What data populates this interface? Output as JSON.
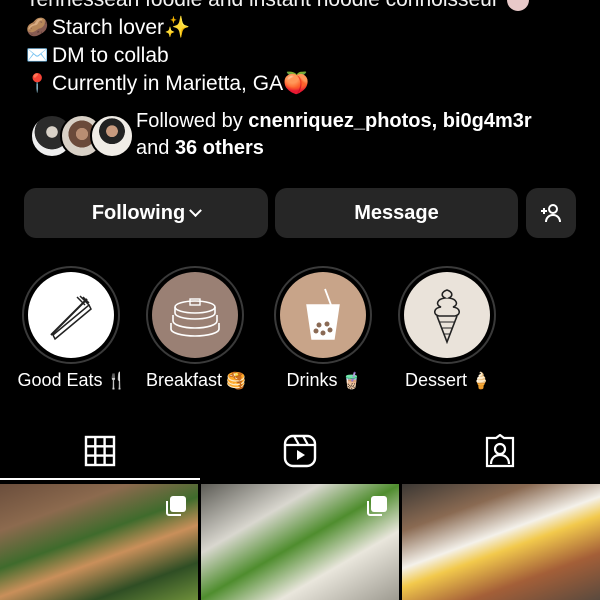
{
  "bio": {
    "cut_line": "Tennessean foodie and instant noodle connoisseur",
    "lines": [
      {
        "icon": "potato-emoji",
        "glyph": "🥔",
        "text": "Starch lover✨"
      },
      {
        "icon": "envelope-emoji",
        "glyph": "✉️",
        "text": "DM to collab"
      },
      {
        "icon": "pin-emoji",
        "glyph": "📍",
        "text": "Currently in Marietta, GA🍑"
      }
    ]
  },
  "followed": {
    "prefix": "Followed by ",
    "names": "cnenriquez_photos, bi0g4m3r",
    "and": "and ",
    "others": "36 others"
  },
  "actions": {
    "following_label": "Following",
    "message_label": "Message",
    "add_icon": "add-person-icon"
  },
  "highlights": [
    {
      "label": "Good Eats",
      "emoji": "🍴",
      "icon": "fork-knife-icon",
      "bg": "#ffffff"
    },
    {
      "label": "Breakfast",
      "emoji": "🥞",
      "icon": "pancakes-icon",
      "bg": "#9a8074"
    },
    {
      "label": "Drinks",
      "emoji": "🧋",
      "icon": "bubble-tea-icon",
      "bg": "#c8a489"
    },
    {
      "label": "Dessert",
      "emoji": "🍦",
      "icon": "ice-cream-icon",
      "bg": "#eae3da"
    }
  ],
  "tabs": [
    {
      "name": "grid",
      "icon": "grid-icon",
      "active": true
    },
    {
      "name": "reels",
      "icon": "reels-icon",
      "active": false
    },
    {
      "name": "tagged",
      "icon": "tagged-icon",
      "active": false
    }
  ],
  "posts": [
    {
      "subject": "tacos",
      "multi": true
    },
    {
      "subject": "noodle-soup",
      "multi": true
    },
    {
      "subject": "fried-egg-breakfast",
      "multi": false
    }
  ],
  "colors": {
    "background": "#000000",
    "button": "#262626",
    "text": "#ffffff"
  }
}
